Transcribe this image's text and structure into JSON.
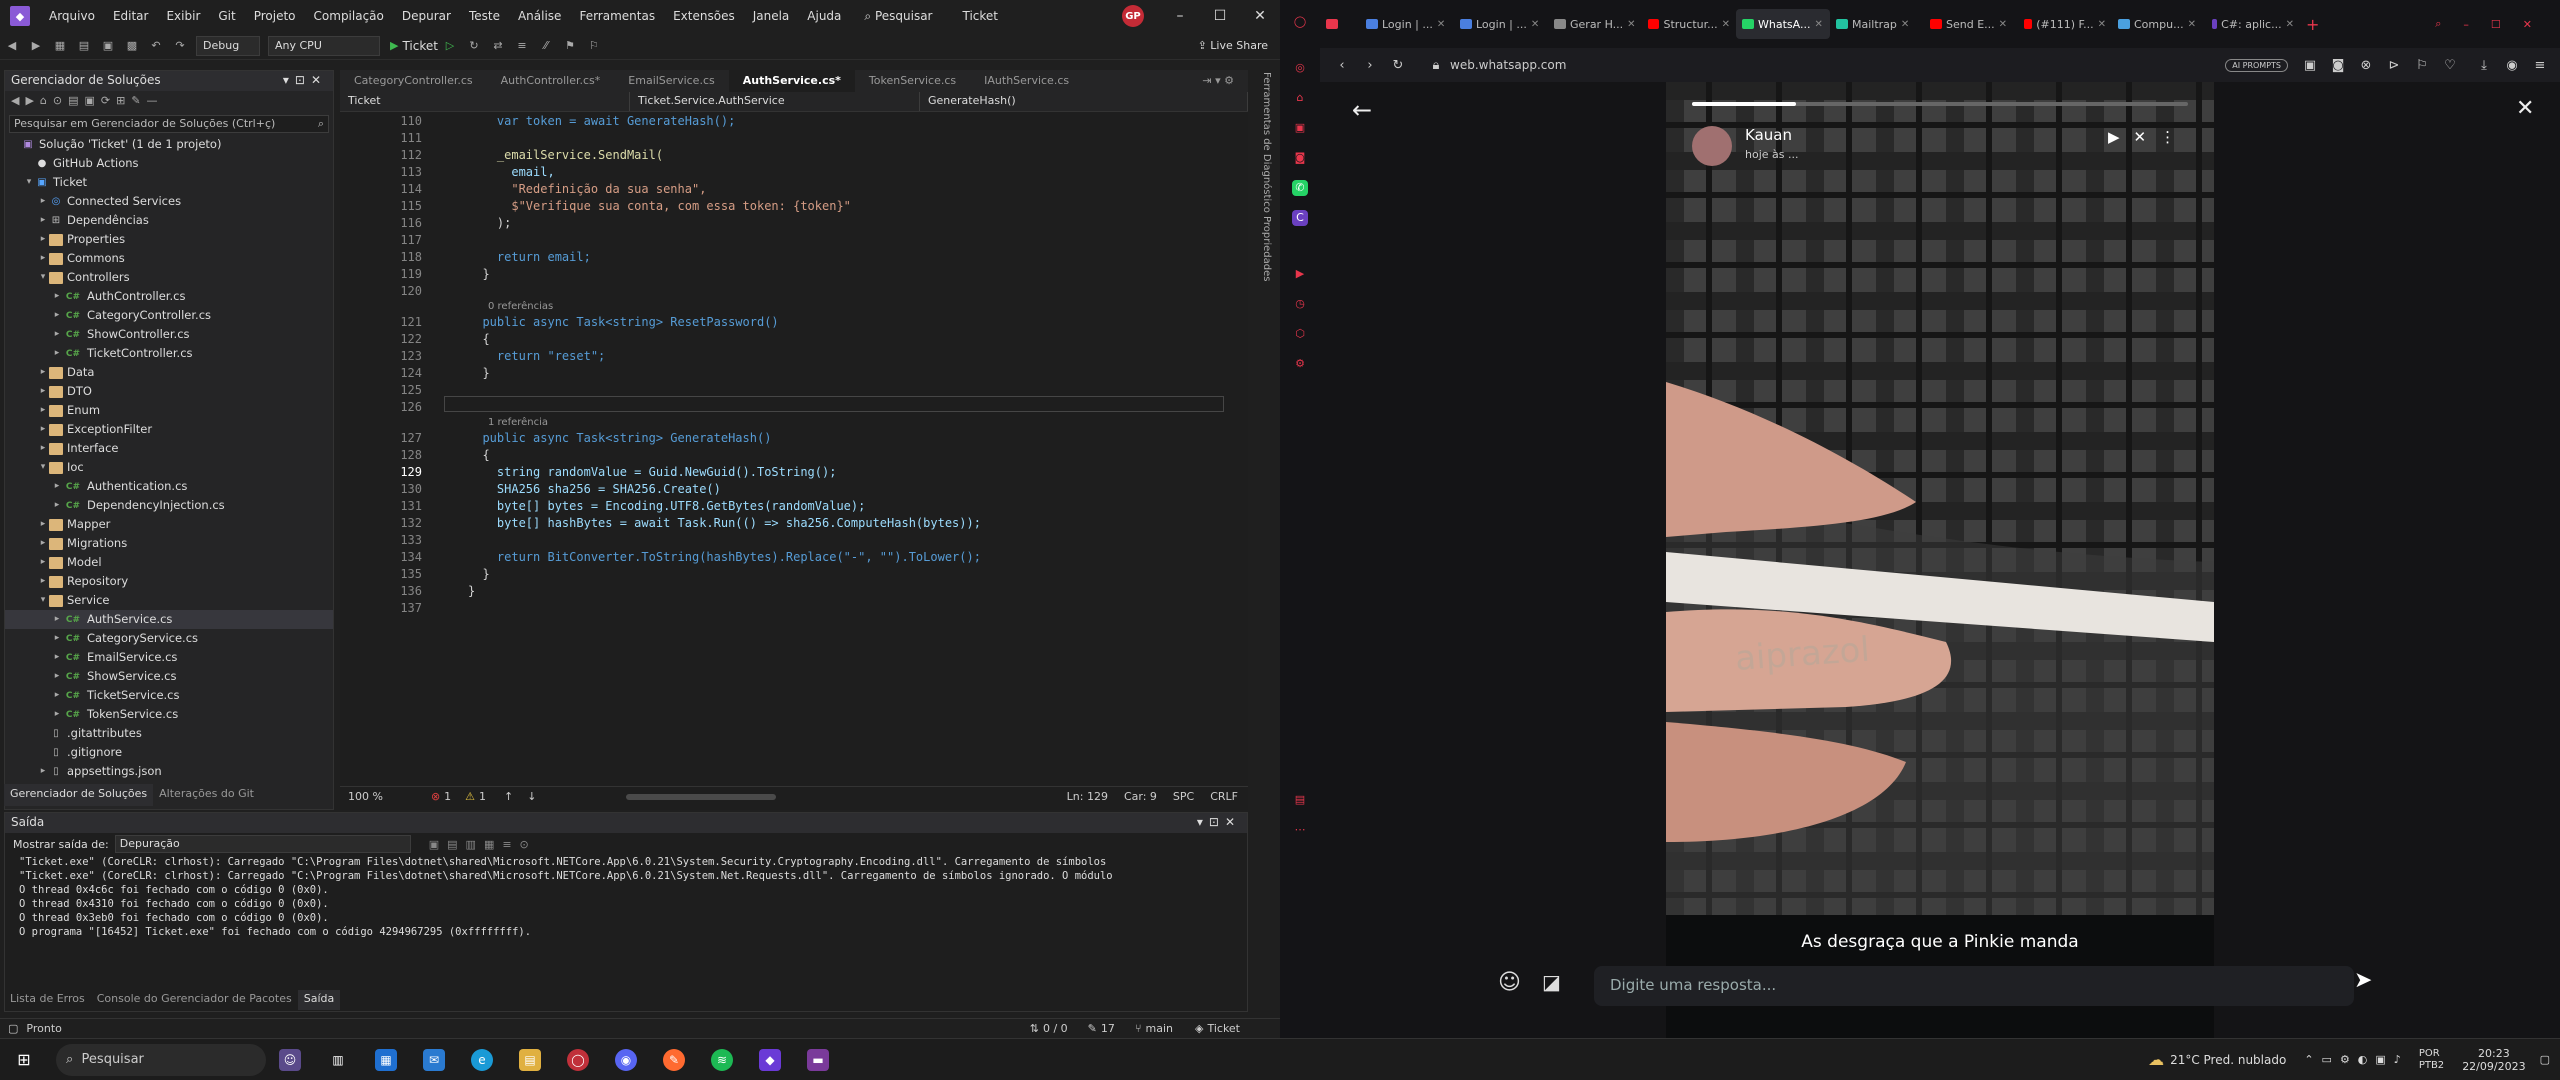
{
  "vs": {
    "menu": [
      "Arquivo",
      "Editar",
      "Exibir",
      "Git",
      "Projeto",
      "Compilação",
      "Depurar",
      "Teste",
      "Análise",
      "Ferramentas",
      "Extensões",
      "Janela",
      "Ajuda"
    ],
    "search": "Pesquisar",
    "solution_name": "Ticket",
    "user_badge": "GP",
    "toolbar": {
      "config": "Debug",
      "platform": "Any CPU",
      "run_target": "Ticket",
      "live_share": "Live Share"
    },
    "solution_explorer": {
      "title": "Gerenciador de Soluções",
      "search_placeholder": "Pesquisar em Gerenciador de Soluções (Ctrl+ç)",
      "items": [
        {
          "label": "Solução 'Ticket' (1 de 1 projeto)",
          "indent": 0,
          "kind": "sln",
          "arrow": ""
        },
        {
          "label": "GitHub Actions",
          "indent": 1,
          "kind": "gh",
          "arrow": ""
        },
        {
          "label": "Ticket",
          "indent": 1,
          "kind": "proj",
          "arrow": "▾"
        },
        {
          "label": "Connected Services",
          "indent": 2,
          "kind": "svc",
          "arrow": "▸"
        },
        {
          "label": "Dependências",
          "indent": 2,
          "kind": "dep",
          "arrow": "▸"
        },
        {
          "label": "Properties",
          "indent": 2,
          "kind": "folder",
          "arrow": "▸"
        },
        {
          "label": "Commons",
          "indent": 2,
          "kind": "folder",
          "arrow": "▸"
        },
        {
          "label": "Controllers",
          "indent": 2,
          "kind": "folder",
          "arrow": "▾"
        },
        {
          "label": "AuthController.cs",
          "indent": 3,
          "kind": "cs",
          "arrow": "▸"
        },
        {
          "label": "CategoryController.cs",
          "indent": 3,
          "kind": "cs",
          "arrow": "▸"
        },
        {
          "label": "ShowController.cs",
          "indent": 3,
          "kind": "cs",
          "arrow": "▸"
        },
        {
          "label": "TicketController.cs",
          "indent": 3,
          "kind": "cs",
          "arrow": "▸"
        },
        {
          "label": "Data",
          "indent": 2,
          "kind": "folder",
          "arrow": "▸"
        },
        {
          "label": "DTO",
          "indent": 2,
          "kind": "folder",
          "arrow": "▸"
        },
        {
          "label": "Enum",
          "indent": 2,
          "kind": "folder",
          "arrow": "▸"
        },
        {
          "label": "ExceptionFilter",
          "indent": 2,
          "kind": "folder",
          "arrow": "▸"
        },
        {
          "label": "Interface",
          "indent": 2,
          "kind": "folder",
          "arrow": "▸"
        },
        {
          "label": "Ioc",
          "indent": 2,
          "kind": "folder",
          "arrow": "▾"
        },
        {
          "label": "Authentication.cs",
          "indent": 3,
          "kind": "cs",
          "arrow": "▸"
        },
        {
          "label": "DependencyInjection.cs",
          "indent": 3,
          "kind": "cs",
          "arrow": "▸"
        },
        {
          "label": "Mapper",
          "indent": 2,
          "kind": "folder",
          "arrow": "▸"
        },
        {
          "label": "Migrations",
          "indent": 2,
          "kind": "folder",
          "arrow": "▸"
        },
        {
          "label": "Model",
          "indent": 2,
          "kind": "folder",
          "arrow": "▸"
        },
        {
          "label": "Repository",
          "indent": 2,
          "kind": "folder",
          "arrow": "▸"
        },
        {
          "label": "Service",
          "indent": 2,
          "kind": "folder",
          "arrow": "▾"
        },
        {
          "label": "AuthService.cs",
          "indent": 3,
          "kind": "cs",
          "arrow": "▸",
          "selected": true
        },
        {
          "label": "CategoryService.cs",
          "indent": 3,
          "kind": "cs",
          "arrow": "▸"
        },
        {
          "label": "EmailService.cs",
          "indent": 3,
          "kind": "cs",
          "arrow": "▸"
        },
        {
          "label": "ShowService.cs",
          "indent": 3,
          "kind": "cs",
          "arrow": "▸"
        },
        {
          "label": "TicketService.cs",
          "indent": 3,
          "kind": "cs",
          "arrow": "▸"
        },
        {
          "label": "TokenService.cs",
          "indent": 3,
          "kind": "cs",
          "arrow": "▸"
        },
        {
          "label": ".gitattributes",
          "indent": 2,
          "kind": "file",
          "arrow": ""
        },
        {
          "label": ".gitignore",
          "indent": 2,
          "kind": "file",
          "arrow": ""
        },
        {
          "label": "appsettings.json",
          "indent": 2,
          "kind": "file",
          "arrow": "▸"
        }
      ],
      "tabs": [
        "Gerenciador de Soluções",
        "Alterações do Git"
      ]
    },
    "editor": {
      "tabs": [
        "CategoryController.cs",
        "AuthController.cs*",
        "EmailService.cs",
        "AuthService.cs*",
        "TokenService.cs",
        "IAuthService.cs"
      ],
      "active_tab": 3,
      "nav": [
        "Ticket",
        "Ticket.Service.AuthService",
        "GenerateHash()"
      ],
      "lines": [
        {
          "n": "110",
          "t": "    var token = await GenerateHash();"
        },
        {
          "n": "111",
          "t": ""
        },
        {
          "n": "112",
          "t": "    _emailService.SendMail("
        },
        {
          "n": "113",
          "t": "      email,"
        },
        {
          "n": "114",
          "t": "      \"Redefinição da sua senha\","
        },
        {
          "n": "115",
          "t": "      $\"Verifique sua conta, com essa token: {token}\""
        },
        {
          "n": "116",
          "t": "    );"
        },
        {
          "n": "117",
          "t": ""
        },
        {
          "n": "118",
          "t": "    return email;"
        },
        {
          "n": "119",
          "t": "  }"
        },
        {
          "n": "120",
          "t": ""
        },
        {
          "n": "121",
          "t": "  public async Task<string> ResetPassword()",
          "ref": "0 referências"
        },
        {
          "n": "122",
          "t": "  {"
        },
        {
          "n": "123",
          "t": "    return \"reset\";"
        },
        {
          "n": "124",
          "t": "  }"
        },
        {
          "n": "125",
          "t": ""
        },
        {
          "n": "126",
          "t": ""
        },
        {
          "n": "127",
          "t": "  public async Task<string> GenerateHash()",
          "ref": "1 referência"
        },
        {
          "n": "128",
          "t": "  {"
        },
        {
          "n": "129",
          "t": "    string randomValue = Guid.NewGuid().ToString();",
          "cur": true
        },
        {
          "n": "130",
          "t": "    SHA256 sha256 = SHA256.Create()"
        },
        {
          "n": "131",
          "t": "    byte[] bytes = Encoding.UTF8.GetBytes(randomValue);"
        },
        {
          "n": "132",
          "t": "    byte[] hashBytes = await Task.Run(() => sha256.ComputeHash(bytes));"
        },
        {
          "n": "133",
          "t": ""
        },
        {
          "n": "134",
          "t": "    return BitConverter.ToString(hashBytes).Replace(\"-\", \"\").ToLower();"
        },
        {
          "n": "135",
          "t": "  }"
        },
        {
          "n": "136",
          "t": "}"
        },
        {
          "n": "137",
          "t": ""
        }
      ],
      "status": {
        "zoom": "100 %",
        "errors": "1",
        "warnings": "1",
        "ln": "Ln: 129",
        "car": "Car: 9",
        "spc": "SPC",
        "eol": "CRLF"
      }
    },
    "side_tabs": "Ferramentas de Diagnóstico   Propriedades",
    "output": {
      "title": "Saída",
      "show_from_label": "Mostrar saída de:",
      "source": "Depuração",
      "lines": [
        "\"Ticket.exe\" (CoreCLR: clrhost): Carregado \"C:\\Program Files\\dotnet\\shared\\Microsoft.NETCore.App\\6.0.21\\System.Security.Cryptography.Encoding.dll\". Carregamento de símbolos",
        "\"Ticket.exe\" (CoreCLR: clrhost): Carregado \"C:\\Program Files\\dotnet\\shared\\Microsoft.NETCore.App\\6.0.21\\System.Net.Requests.dll\". Carregamento de símbolos ignorado. O módulo",
        "O thread 0x4c6c foi fechado com o código 0 (0x0).",
        "O thread 0x4310 foi fechado com o código 0 (0x0).",
        "O thread 0x3eb0 foi fechado com o código 0 (0x0).",
        "O programa \"[16452] Ticket.exe\" foi fechado com o código 4294967295 (0xffffffff)."
      ],
      "tabs": [
        "Lista de Erros",
        "Console do Gerenciador de Pacotes",
        "Saída"
      ]
    },
    "status": {
      "ready": "Pronto",
      "changes": "0 / 0",
      "pencil": "17",
      "branch": "main",
      "repo": "Ticket"
    }
  },
  "browser": {
    "tabs": [
      {
        "label": "",
        "color": "#e8364c"
      },
      {
        "label": "Login | ...",
        "color": "#4a7fe0"
      },
      {
        "label": "Login | ...",
        "color": "#4a7fe0"
      },
      {
        "label": "Gerar H...",
        "color": "#888"
      },
      {
        "label": "Structur...",
        "color": "#ff0000"
      },
      {
        "label": "WhatsA...",
        "color": "#25d366",
        "active": true
      },
      {
        "label": "Mailtrap",
        "color": "#22c3a0"
      },
      {
        "label": "Send E...",
        "color": "#ff0000"
      },
      {
        "label": "(#111) F...",
        "color": "#ff0000"
      },
      {
        "label": "Compu...",
        "color": "#4aa0e0"
      },
      {
        "label": "C#: aplic...",
        "color": "#6a40c0"
      }
    ],
    "url": "web.whatsapp.com",
    "ai_prompts": "AI PROMPTS",
    "status_viewer": {
      "name": "Kauan",
      "subtitle": "hoje às ...",
      "progress": 0.21,
      "caption": "As desgraça que a Pinkie manda",
      "reply_placeholder": "Digite uma resposta..."
    }
  },
  "taskbar": {
    "search": "Pesquisar",
    "weather": "21°C  Pred. nublado",
    "lang": "POR\nPTB2",
    "time": "20:23",
    "date": "22/09/2023"
  }
}
